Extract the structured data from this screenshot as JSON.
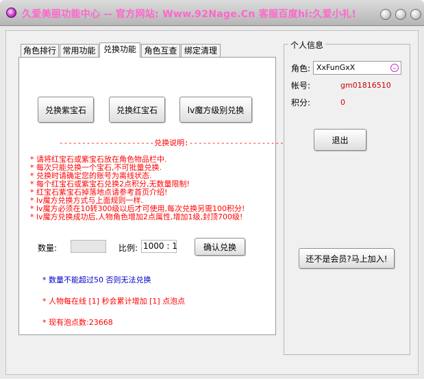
{
  "window": {
    "title": "久爱美丽功能中心 -- 官方网站: Www.92Nage.Cn 客服百度hi:久爱小礼!"
  },
  "tabs": [
    {
      "label": "角色排行"
    },
    {
      "label": "常用功能"
    },
    {
      "label": "兑换功能"
    },
    {
      "label": "角色互查"
    },
    {
      "label": "绑定清理"
    }
  ],
  "exchange": {
    "buttons": {
      "purple": "兑换紫宝石",
      "red": "兑换红宝石",
      "cube": "lv魔方级别兑换"
    },
    "divider": "---------------------兑换说明:---------------------",
    "rules": [
      "* 请将红宝石或紫宝石放在角色物品栏中.",
      "* 每次只能兑换一个宝石,不可批量兑换.",
      "* 兑换时请确定您的账号为离线状态.",
      "* 每个红宝石或紫宝石兑换2点积分,无数量限制!",
      "* 红宝石紫宝石掉落地点请参考首页介绍!",
      "* lv魔方兑换方式与上面规则一样.",
      "* lv魔方必须在10转300级以后才可使用,每次兑换另需100积分!",
      "* lv魔方兑换成功后,人物角色增加2点属性,增加1级,封顶700级!"
    ],
    "quantity_label": "数量:",
    "quantity_value": "",
    "ratio_label": "比例:",
    "ratio_value": "1000 : 1",
    "confirm_button": "确认兑换",
    "note_limit": "* 数量不能超过50 否则无法兑换",
    "note_online": "* 人物每在线 [1] 秒会累计增加 [1] 点泡点",
    "note_points_label": "* 现有泡点数:",
    "note_points_value": "23668"
  },
  "info": {
    "group_title": "个人信息",
    "role_label": "角色:",
    "role_value": "XxFunGxX",
    "account_label": "帐号:",
    "account_value": "gm01816510",
    "points_label": "积分:",
    "points_value": "0",
    "logout_button": "退出",
    "join_button": "还不是会员?马上加入!"
  },
  "colors": {
    "title_text": "#ff66cc",
    "rule_text": "#ff0000",
    "note_text": "#0000cc"
  }
}
